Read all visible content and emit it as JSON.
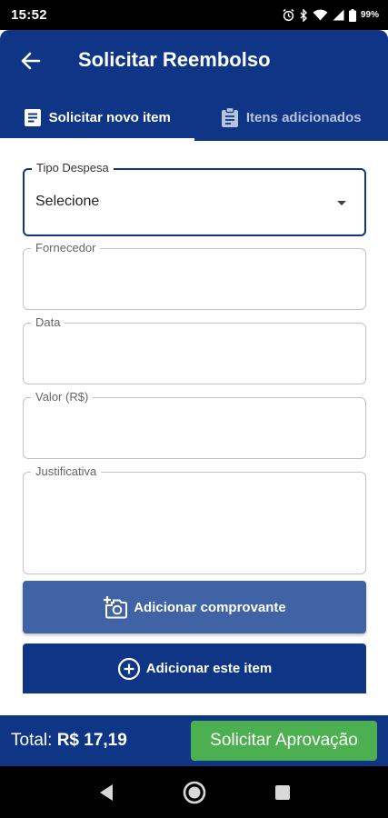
{
  "status": {
    "time": "15:52",
    "battery": "99%"
  },
  "appbar": {
    "title": "Solicitar Reembolso",
    "tabs": [
      {
        "label": "Solicitar novo item",
        "active": true
      },
      {
        "label": "Itens adicionados",
        "active": false
      }
    ]
  },
  "form": {
    "tipo": {
      "label": "Tipo Despesa",
      "value": "Selecione"
    },
    "fornecedor": {
      "label": "Fornecedor",
      "value": ""
    },
    "data": {
      "label": "Data",
      "value": ""
    },
    "valor": {
      "label": "Valor (R$)",
      "value": ""
    },
    "justificativa": {
      "label": "Justificativa",
      "value": ""
    }
  },
  "buttons": {
    "add_receipt": "Adicionar comprovante",
    "add_item": "Adicionar este item"
  },
  "footer": {
    "total_label": "Total: ",
    "total_value": "R$ 17,19",
    "approve": "Solicitar Aprovação"
  },
  "colors": {
    "primary": "#0f3686",
    "secondary_button": "#3f63a4",
    "approve": "#4caf50"
  },
  "icons": [
    "alarm-icon",
    "bluetooth-icon",
    "wifi-icon",
    "signal-icon",
    "battery-icon",
    "back-arrow-icon",
    "document-icon",
    "clipboard-icon",
    "add-photo-icon",
    "add-circle-icon",
    "nav-back-icon",
    "nav-home-icon",
    "nav-recents-icon"
  ]
}
